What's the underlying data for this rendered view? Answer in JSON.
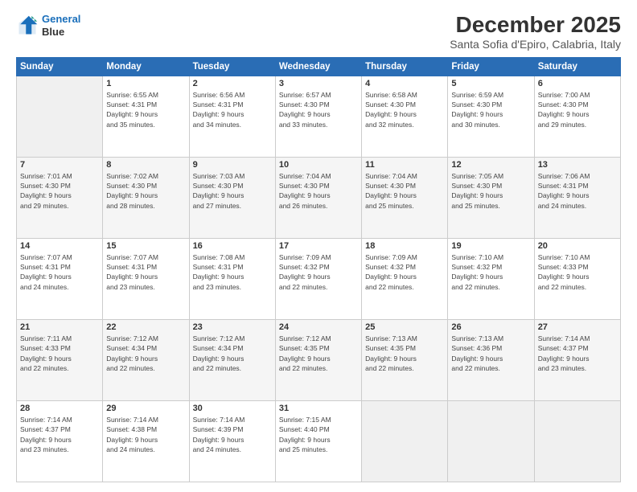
{
  "header": {
    "logo_line1": "General",
    "logo_line2": "Blue",
    "month_title": "December 2025",
    "subtitle": "Santa Sofia d'Epiro, Calabria, Italy"
  },
  "weekdays": [
    "Sunday",
    "Monday",
    "Tuesday",
    "Wednesday",
    "Thursday",
    "Friday",
    "Saturday"
  ],
  "weeks": [
    [
      {
        "num": "",
        "sunrise": "",
        "sunset": "",
        "daylight": "",
        "daylight2": ""
      },
      {
        "num": "1",
        "sunrise": "6:55 AM",
        "sunset": "4:31 PM",
        "daylight": "9 hours",
        "daylight2": "and 35 minutes."
      },
      {
        "num": "2",
        "sunrise": "6:56 AM",
        "sunset": "4:31 PM",
        "daylight": "9 hours",
        "daylight2": "and 34 minutes."
      },
      {
        "num": "3",
        "sunrise": "6:57 AM",
        "sunset": "4:30 PM",
        "daylight": "9 hours",
        "daylight2": "and 33 minutes."
      },
      {
        "num": "4",
        "sunrise": "6:58 AM",
        "sunset": "4:30 PM",
        "daylight": "9 hours",
        "daylight2": "and 32 minutes."
      },
      {
        "num": "5",
        "sunrise": "6:59 AM",
        "sunset": "4:30 PM",
        "daylight": "9 hours",
        "daylight2": "and 30 minutes."
      },
      {
        "num": "6",
        "sunrise": "7:00 AM",
        "sunset": "4:30 PM",
        "daylight": "9 hours",
        "daylight2": "and 29 minutes."
      }
    ],
    [
      {
        "num": "7",
        "sunrise": "7:01 AM",
        "sunset": "4:30 PM",
        "daylight": "9 hours",
        "daylight2": "and 29 minutes."
      },
      {
        "num": "8",
        "sunrise": "7:02 AM",
        "sunset": "4:30 PM",
        "daylight": "9 hours",
        "daylight2": "and 28 minutes."
      },
      {
        "num": "9",
        "sunrise": "7:03 AM",
        "sunset": "4:30 PM",
        "daylight": "9 hours",
        "daylight2": "and 27 minutes."
      },
      {
        "num": "10",
        "sunrise": "7:04 AM",
        "sunset": "4:30 PM",
        "daylight": "9 hours",
        "daylight2": "and 26 minutes."
      },
      {
        "num": "11",
        "sunrise": "7:04 AM",
        "sunset": "4:30 PM",
        "daylight": "9 hours",
        "daylight2": "and 25 minutes."
      },
      {
        "num": "12",
        "sunrise": "7:05 AM",
        "sunset": "4:30 PM",
        "daylight": "9 hours",
        "daylight2": "and 25 minutes."
      },
      {
        "num": "13",
        "sunrise": "7:06 AM",
        "sunset": "4:31 PM",
        "daylight": "9 hours",
        "daylight2": "and 24 minutes."
      }
    ],
    [
      {
        "num": "14",
        "sunrise": "7:07 AM",
        "sunset": "4:31 PM",
        "daylight": "9 hours",
        "daylight2": "and 24 minutes."
      },
      {
        "num": "15",
        "sunrise": "7:07 AM",
        "sunset": "4:31 PM",
        "daylight": "9 hours",
        "daylight2": "and 23 minutes."
      },
      {
        "num": "16",
        "sunrise": "7:08 AM",
        "sunset": "4:31 PM",
        "daylight": "9 hours",
        "daylight2": "and 23 minutes."
      },
      {
        "num": "17",
        "sunrise": "7:09 AM",
        "sunset": "4:32 PM",
        "daylight": "9 hours",
        "daylight2": "and 22 minutes."
      },
      {
        "num": "18",
        "sunrise": "7:09 AM",
        "sunset": "4:32 PM",
        "daylight": "9 hours",
        "daylight2": "and 22 minutes."
      },
      {
        "num": "19",
        "sunrise": "7:10 AM",
        "sunset": "4:32 PM",
        "daylight": "9 hours",
        "daylight2": "and 22 minutes."
      },
      {
        "num": "20",
        "sunrise": "7:10 AM",
        "sunset": "4:33 PM",
        "daylight": "9 hours",
        "daylight2": "and 22 minutes."
      }
    ],
    [
      {
        "num": "21",
        "sunrise": "7:11 AM",
        "sunset": "4:33 PM",
        "daylight": "9 hours",
        "daylight2": "and 22 minutes."
      },
      {
        "num": "22",
        "sunrise": "7:12 AM",
        "sunset": "4:34 PM",
        "daylight": "9 hours",
        "daylight2": "and 22 minutes."
      },
      {
        "num": "23",
        "sunrise": "7:12 AM",
        "sunset": "4:34 PM",
        "daylight": "9 hours",
        "daylight2": "and 22 minutes."
      },
      {
        "num": "24",
        "sunrise": "7:12 AM",
        "sunset": "4:35 PM",
        "daylight": "9 hours",
        "daylight2": "and 22 minutes."
      },
      {
        "num": "25",
        "sunrise": "7:13 AM",
        "sunset": "4:35 PM",
        "daylight": "9 hours",
        "daylight2": "and 22 minutes."
      },
      {
        "num": "26",
        "sunrise": "7:13 AM",
        "sunset": "4:36 PM",
        "daylight": "9 hours",
        "daylight2": "and 22 minutes."
      },
      {
        "num": "27",
        "sunrise": "7:14 AM",
        "sunset": "4:37 PM",
        "daylight": "9 hours",
        "daylight2": "and 23 minutes."
      }
    ],
    [
      {
        "num": "28",
        "sunrise": "7:14 AM",
        "sunset": "4:37 PM",
        "daylight": "9 hours",
        "daylight2": "and 23 minutes."
      },
      {
        "num": "29",
        "sunrise": "7:14 AM",
        "sunset": "4:38 PM",
        "daylight": "9 hours",
        "daylight2": "and 24 minutes."
      },
      {
        "num": "30",
        "sunrise": "7:14 AM",
        "sunset": "4:39 PM",
        "daylight": "9 hours",
        "daylight2": "and 24 minutes."
      },
      {
        "num": "31",
        "sunrise": "7:15 AM",
        "sunset": "4:40 PM",
        "daylight": "9 hours",
        "daylight2": "and 25 minutes."
      },
      {
        "num": "",
        "sunrise": "",
        "sunset": "",
        "daylight": "",
        "daylight2": ""
      },
      {
        "num": "",
        "sunrise": "",
        "sunset": "",
        "daylight": "",
        "daylight2": ""
      },
      {
        "num": "",
        "sunrise": "",
        "sunset": "",
        "daylight": "",
        "daylight2": ""
      }
    ]
  ]
}
